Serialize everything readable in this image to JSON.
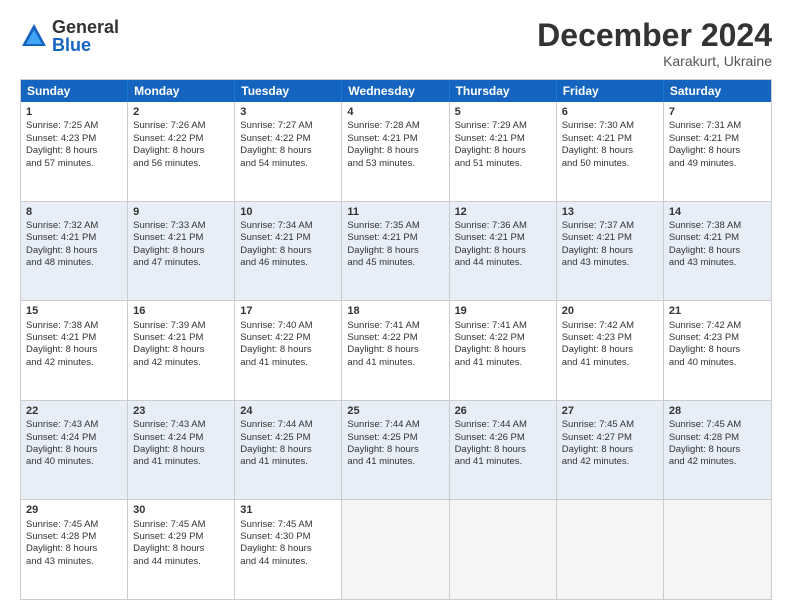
{
  "logo": {
    "general": "General",
    "blue": "Blue"
  },
  "title": "December 2024",
  "subtitle": "Karakurt, Ukraine",
  "header_days": [
    "Sunday",
    "Monday",
    "Tuesday",
    "Wednesday",
    "Thursday",
    "Friday",
    "Saturday"
  ],
  "rows": [
    [
      {
        "day": "1",
        "lines": [
          "Sunrise: 7:25 AM",
          "Sunset: 4:23 PM",
          "Daylight: 8 hours",
          "and 57 minutes."
        ]
      },
      {
        "day": "2",
        "lines": [
          "Sunrise: 7:26 AM",
          "Sunset: 4:22 PM",
          "Daylight: 8 hours",
          "and 56 minutes."
        ]
      },
      {
        "day": "3",
        "lines": [
          "Sunrise: 7:27 AM",
          "Sunset: 4:22 PM",
          "Daylight: 8 hours",
          "and 54 minutes."
        ]
      },
      {
        "day": "4",
        "lines": [
          "Sunrise: 7:28 AM",
          "Sunset: 4:21 PM",
          "Daylight: 8 hours",
          "and 53 minutes."
        ]
      },
      {
        "day": "5",
        "lines": [
          "Sunrise: 7:29 AM",
          "Sunset: 4:21 PM",
          "Daylight: 8 hours",
          "and 51 minutes."
        ]
      },
      {
        "day": "6",
        "lines": [
          "Sunrise: 7:30 AM",
          "Sunset: 4:21 PM",
          "Daylight: 8 hours",
          "and 50 minutes."
        ]
      },
      {
        "day": "7",
        "lines": [
          "Sunrise: 7:31 AM",
          "Sunset: 4:21 PM",
          "Daylight: 8 hours",
          "and 49 minutes."
        ]
      }
    ],
    [
      {
        "day": "8",
        "lines": [
          "Sunrise: 7:32 AM",
          "Sunset: 4:21 PM",
          "Daylight: 8 hours",
          "and 48 minutes."
        ]
      },
      {
        "day": "9",
        "lines": [
          "Sunrise: 7:33 AM",
          "Sunset: 4:21 PM",
          "Daylight: 8 hours",
          "and 47 minutes."
        ]
      },
      {
        "day": "10",
        "lines": [
          "Sunrise: 7:34 AM",
          "Sunset: 4:21 PM",
          "Daylight: 8 hours",
          "and 46 minutes."
        ]
      },
      {
        "day": "11",
        "lines": [
          "Sunrise: 7:35 AM",
          "Sunset: 4:21 PM",
          "Daylight: 8 hours",
          "and 45 minutes."
        ]
      },
      {
        "day": "12",
        "lines": [
          "Sunrise: 7:36 AM",
          "Sunset: 4:21 PM",
          "Daylight: 8 hours",
          "and 44 minutes."
        ]
      },
      {
        "day": "13",
        "lines": [
          "Sunrise: 7:37 AM",
          "Sunset: 4:21 PM",
          "Daylight: 8 hours",
          "and 43 minutes."
        ]
      },
      {
        "day": "14",
        "lines": [
          "Sunrise: 7:38 AM",
          "Sunset: 4:21 PM",
          "Daylight: 8 hours",
          "and 43 minutes."
        ]
      }
    ],
    [
      {
        "day": "15",
        "lines": [
          "Sunrise: 7:38 AM",
          "Sunset: 4:21 PM",
          "Daylight: 8 hours",
          "and 42 minutes."
        ]
      },
      {
        "day": "16",
        "lines": [
          "Sunrise: 7:39 AM",
          "Sunset: 4:21 PM",
          "Daylight: 8 hours",
          "and 42 minutes."
        ]
      },
      {
        "day": "17",
        "lines": [
          "Sunrise: 7:40 AM",
          "Sunset: 4:22 PM",
          "Daylight: 8 hours",
          "and 41 minutes."
        ]
      },
      {
        "day": "18",
        "lines": [
          "Sunrise: 7:41 AM",
          "Sunset: 4:22 PM",
          "Daylight: 8 hours",
          "and 41 minutes."
        ]
      },
      {
        "day": "19",
        "lines": [
          "Sunrise: 7:41 AM",
          "Sunset: 4:22 PM",
          "Daylight: 8 hours",
          "and 41 minutes."
        ]
      },
      {
        "day": "20",
        "lines": [
          "Sunrise: 7:42 AM",
          "Sunset: 4:23 PM",
          "Daylight: 8 hours",
          "and 41 minutes."
        ]
      },
      {
        "day": "21",
        "lines": [
          "Sunrise: 7:42 AM",
          "Sunset: 4:23 PM",
          "Daylight: 8 hours",
          "and 40 minutes."
        ]
      }
    ],
    [
      {
        "day": "22",
        "lines": [
          "Sunrise: 7:43 AM",
          "Sunset: 4:24 PM",
          "Daylight: 8 hours",
          "and 40 minutes."
        ]
      },
      {
        "day": "23",
        "lines": [
          "Sunrise: 7:43 AM",
          "Sunset: 4:24 PM",
          "Daylight: 8 hours",
          "and 41 minutes."
        ]
      },
      {
        "day": "24",
        "lines": [
          "Sunrise: 7:44 AM",
          "Sunset: 4:25 PM",
          "Daylight: 8 hours",
          "and 41 minutes."
        ]
      },
      {
        "day": "25",
        "lines": [
          "Sunrise: 7:44 AM",
          "Sunset: 4:25 PM",
          "Daylight: 8 hours",
          "and 41 minutes."
        ]
      },
      {
        "day": "26",
        "lines": [
          "Sunrise: 7:44 AM",
          "Sunset: 4:26 PM",
          "Daylight: 8 hours",
          "and 41 minutes."
        ]
      },
      {
        "day": "27",
        "lines": [
          "Sunrise: 7:45 AM",
          "Sunset: 4:27 PM",
          "Daylight: 8 hours",
          "and 42 minutes."
        ]
      },
      {
        "day": "28",
        "lines": [
          "Sunrise: 7:45 AM",
          "Sunset: 4:28 PM",
          "Daylight: 8 hours",
          "and 42 minutes."
        ]
      }
    ],
    [
      {
        "day": "29",
        "lines": [
          "Sunrise: 7:45 AM",
          "Sunset: 4:28 PM",
          "Daylight: 8 hours",
          "and 43 minutes."
        ]
      },
      {
        "day": "30",
        "lines": [
          "Sunrise: 7:45 AM",
          "Sunset: 4:29 PM",
          "Daylight: 8 hours",
          "and 44 minutes."
        ]
      },
      {
        "day": "31",
        "lines": [
          "Sunrise: 7:45 AM",
          "Sunset: 4:30 PM",
          "Daylight: 8 hours",
          "and 44 minutes."
        ]
      },
      {
        "day": "",
        "lines": []
      },
      {
        "day": "",
        "lines": []
      },
      {
        "day": "",
        "lines": []
      },
      {
        "day": "",
        "lines": []
      }
    ]
  ]
}
